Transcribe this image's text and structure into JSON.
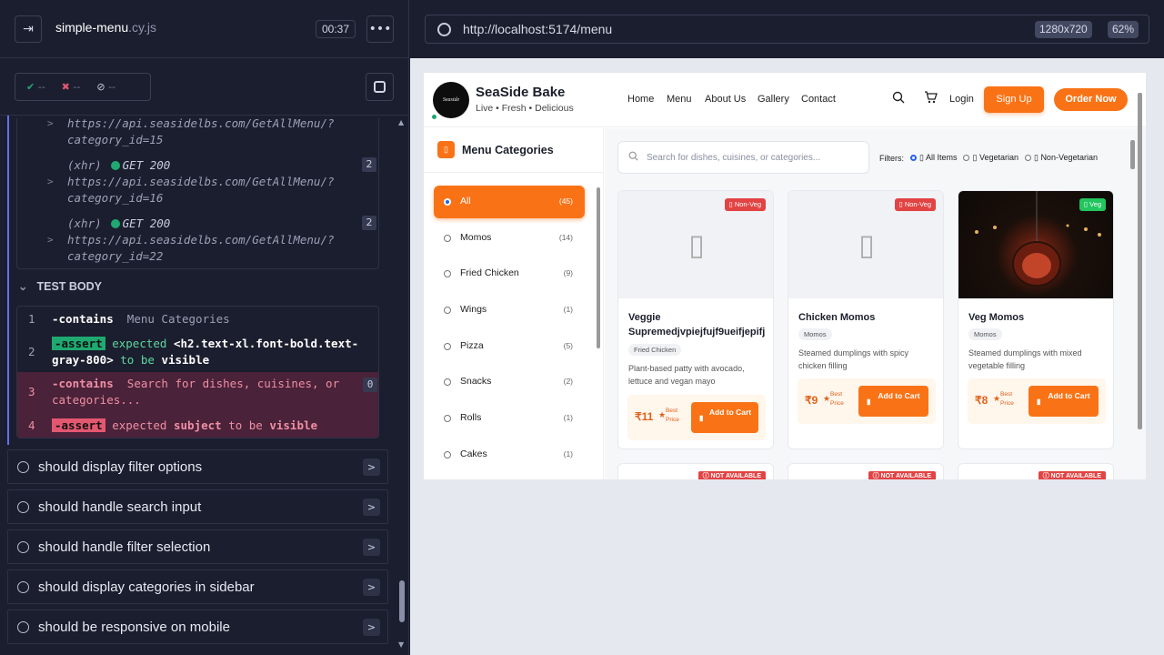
{
  "runner": {
    "spec_name": "simple-menu",
    "spec_ext": ".cy.js",
    "timer": "00:37",
    "stats": {
      "passed": "--",
      "failed": "--",
      "pending": "--"
    },
    "routes": [
      {
        "prefix": "(xhr)",
        "method": "GET 200",
        "url": "https://api.seasidelbs.com/GetAllMenu/?category_id=15",
        "count": "2"
      },
      {
        "prefix": "(xhr)",
        "method": "GET 200",
        "url": "https://api.seasidelbs.com/GetAllMenu/?category_id=16",
        "count": "2"
      },
      {
        "prefix": "(xhr)",
        "method": "GET 200",
        "url": "https://api.seasidelbs.com/GetAllMenu/?category_id=22",
        "count": "2"
      }
    ],
    "test_body_label": "TEST BODY",
    "commands": [
      {
        "num": "1",
        "name": "-contains",
        "msg": "Menu Categories"
      },
      {
        "num": "2",
        "name": "-assert",
        "msg_a": "expected",
        "msg_b": "<h2.text-xl.font-bold.text-gray-800>",
        "msg_c": "to be",
        "msg_d": "visible"
      },
      {
        "num": "3",
        "name": "-contains",
        "msg": "Search for dishes, cuisines, or categories...",
        "count": "0"
      },
      {
        "num": "4",
        "name": "-assert",
        "msg_a": "expected",
        "msg_b": "subject",
        "msg_c": "to be",
        "msg_d": "visible"
      }
    ],
    "tests": [
      "should display filter options",
      "should handle search input",
      "should handle filter selection",
      "should display categories in sidebar",
      "should be responsive on mobile"
    ]
  },
  "browser": {
    "url": "http://localhost:5174/menu",
    "viewport": "1280x720",
    "zoom": "62%"
  },
  "app": {
    "logo_text": "Seaside",
    "brand": "SeaSide Bake",
    "tagline": "Live • Fresh • Delicious",
    "nav": [
      "Home",
      "Menu",
      "About Us",
      "Gallery",
      "Contact"
    ],
    "login": "Login",
    "signup": "Sign Up",
    "order": "Order Now",
    "sidebar_title": "Menu Categories",
    "categories": [
      {
        "name": "All",
        "count": "(45)"
      },
      {
        "name": "Momos",
        "count": "(14)"
      },
      {
        "name": "Fried Chicken",
        "count": "(9)"
      },
      {
        "name": "Wings",
        "count": "(1)"
      },
      {
        "name": "Pizza",
        "count": "(5)"
      },
      {
        "name": "Snacks",
        "count": "(2)"
      },
      {
        "name": "Rolls",
        "count": "(1)"
      },
      {
        "name": "Cakes",
        "count": "(1)"
      }
    ],
    "search_placeholder": "Search for dishes, cuisines, or categories...",
    "filters_label": "Filters:",
    "filters": [
      "All Items",
      "Vegetarian",
      "Non-Vegetarian"
    ],
    "cards": [
      {
        "badge": "Non-Veg",
        "name": "Veggie Supremedjvpiejfujf9ueifjepifj",
        "category": "Fried Chicken",
        "desc": "Plant-based patty with avocado, lettuce and vegan mayo",
        "price": "₹11",
        "best": "Best Price",
        "btn": "Add to Cart"
      },
      {
        "badge": "Non-Veg",
        "name": "Chicken Momos",
        "category": "Momos",
        "desc": "Steamed dumplings with spicy chicken filling",
        "price": "₹9",
        "best": "Best Price",
        "btn": "Add to Cart"
      },
      {
        "badge": "Veg",
        "name": "Veg Momos",
        "category": "Momos",
        "desc": "Steamed dumplings with mixed vegetable filling",
        "price": "₹8",
        "best": "Best Price",
        "btn": "Add to Cart"
      }
    ],
    "not_available": "NOT AVAILABLE",
    "colors": {
      "accent": "#f97316",
      "nonveg": "#e24343",
      "veg": "#22c55e",
      "pass": "#1fa971",
      "fail": "#e45770"
    }
  }
}
